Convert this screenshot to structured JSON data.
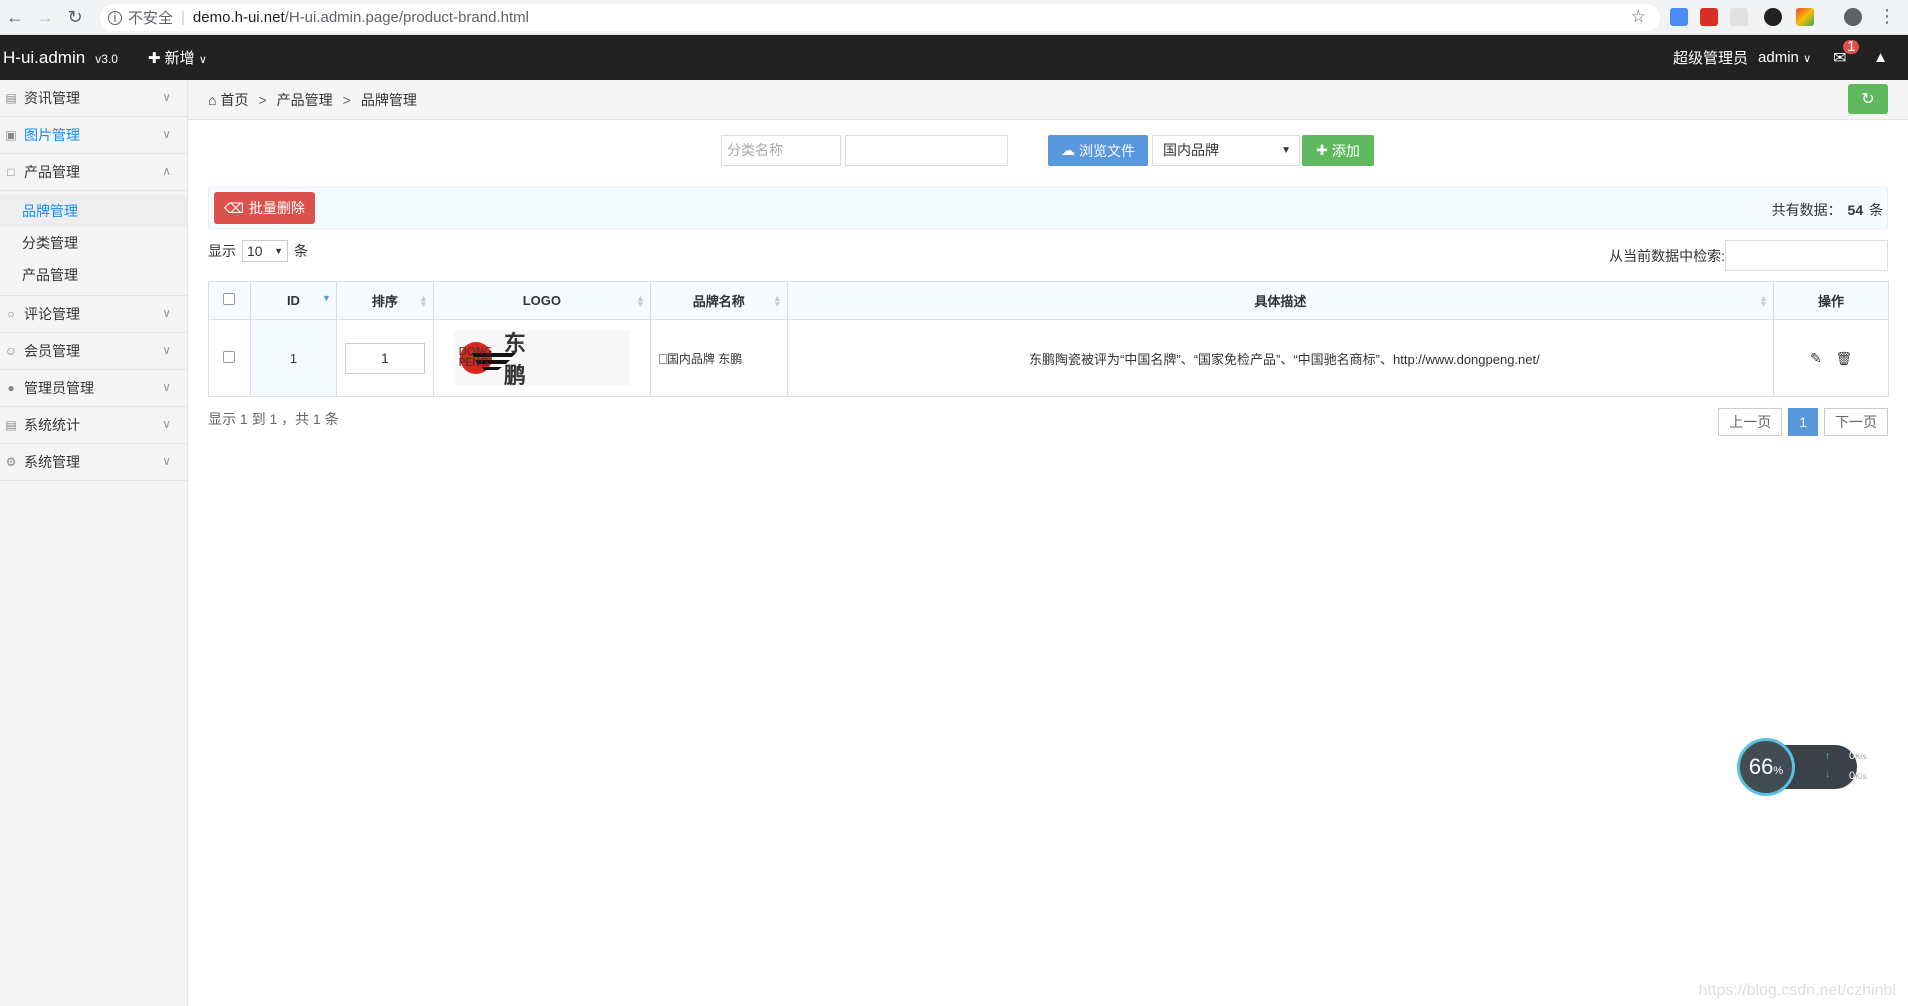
{
  "browser": {
    "insecure_label": "不安全",
    "url_host": "demo.h-ui.net",
    "url_path": "/H-ui.admin.page/product-brand.html"
  },
  "header": {
    "app_name": "H-ui.admin",
    "version": "v3.0",
    "add_new": "新增",
    "role": "超级管理员",
    "user": "admin",
    "message_count": "1"
  },
  "sidebar": {
    "items": [
      {
        "label": "资讯管理"
      },
      {
        "label": "图片管理"
      },
      {
        "label": "产品管理"
      },
      {
        "label": "评论管理"
      },
      {
        "label": "会员管理"
      },
      {
        "label": "管理员管理"
      },
      {
        "label": "系统统计"
      },
      {
        "label": "系统管理"
      }
    ],
    "product_sub": [
      {
        "label": "品牌管理"
      },
      {
        "label": "分类管理"
      },
      {
        "label": "产品管理"
      }
    ]
  },
  "breadcrumb": {
    "home": "首页",
    "level1": "产品管理",
    "level2": "品牌管理",
    "sep": ">"
  },
  "filter": {
    "category_placeholder": "分类名称",
    "browse_label": "浏览文件",
    "brand_type": "国内品牌",
    "add_label": "添加"
  },
  "toolbar": {
    "batch_delete": "批量删除",
    "total_prefix": "共有数据：",
    "total_count": "54",
    "total_suffix": "条"
  },
  "list_controls": {
    "show_prefix": "显示",
    "page_length": "10",
    "show_suffix": "条",
    "search_label": "从当前数据中检索:"
  },
  "table": {
    "headers": {
      "id": "ID",
      "order": "排序",
      "logo": "LOGO",
      "brand_name": "品牌名称",
      "description": "具体描述",
      "actions": "操作"
    },
    "rows": [
      {
        "id": "1",
        "order": "1",
        "logo_text_1": "DONG",
        "logo_text_2": "PENG",
        "logo_text_cn": "东鹏",
        "brand_img_alt": "国内品牌",
        "brand_name": "东鹏",
        "description": "东鹏陶瓷被评为“中国名牌”、“国家免检产品”、“中国驰名商标”、http://www.dongpeng.net/"
      }
    ]
  },
  "footer": {
    "info": "显示 1 到 1 ，共 1 条",
    "prev": "上一页",
    "current_page": "1",
    "next": "下一页"
  },
  "speed_widget": {
    "percent": "66",
    "percent_sign": "%",
    "up_value": "0",
    "down_value": "0",
    "unit": "K/s"
  },
  "watermark": "https://blog.csdn.net/czhinbl",
  "colors": {
    "header_bg": "#222222",
    "accent_blue": "#5a98de",
    "accent_green": "#5eb95e",
    "danger_red": "#dd514c",
    "active_link": "#148cf1"
  }
}
